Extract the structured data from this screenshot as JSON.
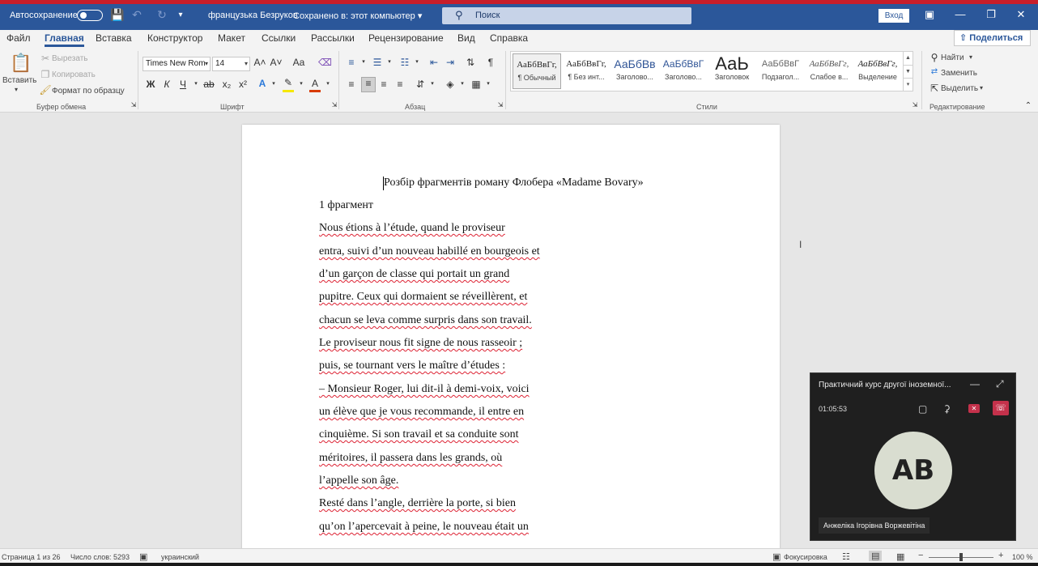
{
  "titlebar": {
    "autosave_label": "Автосохранение",
    "doc_name": "французька Безруков",
    "save_status": "Сохранено в: этот компьютер",
    "search_placeholder": "Поиск",
    "signin_label": "Вход"
  },
  "tabs": [
    "Файл",
    "Главная",
    "Вставка",
    "Конструктор",
    "Макет",
    "Ссылки",
    "Рассылки",
    "Рецензирование",
    "Вид",
    "Справка"
  ],
  "share_label": "Поделиться",
  "ribbon": {
    "clipboard": {
      "paste": "Вставить",
      "cut": "Вырезать",
      "copy": "Копировать",
      "format_painter": "Формат по образцу",
      "group": "Буфер обмена"
    },
    "font": {
      "name": "Times New Rom",
      "size": "14",
      "group": "Шрифт",
      "bold": "Ж",
      "italic": "К",
      "underline": "Ч",
      "strike": "ab",
      "sub": "x₂",
      "sup": "x²",
      "grow": "A˄",
      "shrink": "A˅",
      "case": "Aa",
      "highlight_color": "#f6e800",
      "font_color": "#d83b01"
    },
    "paragraph": {
      "group": "Абзац"
    },
    "styles": {
      "group": "Стили",
      "items": [
        {
          "sample": "АаБбВвГг,",
          "name": "¶ Обычный"
        },
        {
          "sample": "АаБбВвГг,",
          "name": "¶ Без инт..."
        },
        {
          "sample": "АаБбВв",
          "name": "Заголово..."
        },
        {
          "sample": "АаБбВвГ",
          "name": "Заголово..."
        },
        {
          "sample": "АаЬ",
          "name": "Заголовок"
        },
        {
          "sample": "АаБбВвГ",
          "name": "Подзагол..."
        },
        {
          "sample": "АаБбВвГг,",
          "name": "Слабое в..."
        },
        {
          "sample": "АаБбВвГг,",
          "name": "Выделение"
        }
      ]
    },
    "editing": {
      "find": "Найти",
      "replace": "Заменить",
      "select": "Выделить",
      "group": "Редактирование"
    }
  },
  "document": {
    "title": "Розбір фрагментів роману Флобера «Madame Bovary»",
    "fragment_label": "1 фрагмент",
    "lines": [
      "Nous étions à l’étude, quand le proviseur",
      "entra, suivi d’un nouveau habillé en bourgeois et",
      "d’un garçon de classe qui portait un grand",
      "pupitre. Ceux qui dormaient se réveillèrent, et",
      "chacun se leva comme surpris dans son travail.",
      "Le proviseur nous fit signe de nous rasseoir ;",
      "puis, se tournant vers le maître d’études :",
      "– Monsieur Roger, lui dit-il à demi-voix, voici",
      "un élève que je vous recommande, il entre en",
      "cinquième. Si son travail et sa conduite sont",
      "méritoires, il passera dans les grands, où",
      "l’appelle son âge.",
      "Resté dans l’angle, derrière la porte, si bien",
      "qu’on l’apercevait à peine, le nouveau était un"
    ]
  },
  "statusbar": {
    "page": "Страница 1 из 26",
    "words": "Число слов: 5293",
    "language": "украинский",
    "focus": "Фокусировка",
    "zoom": "100 %",
    "zoom_level": 1.0
  },
  "call": {
    "title": "Практичний курс другої іноземної...",
    "timer": "01:05:53",
    "initials": "AB",
    "participant": "Анжеліка Ігорівна Воржевітіна"
  }
}
